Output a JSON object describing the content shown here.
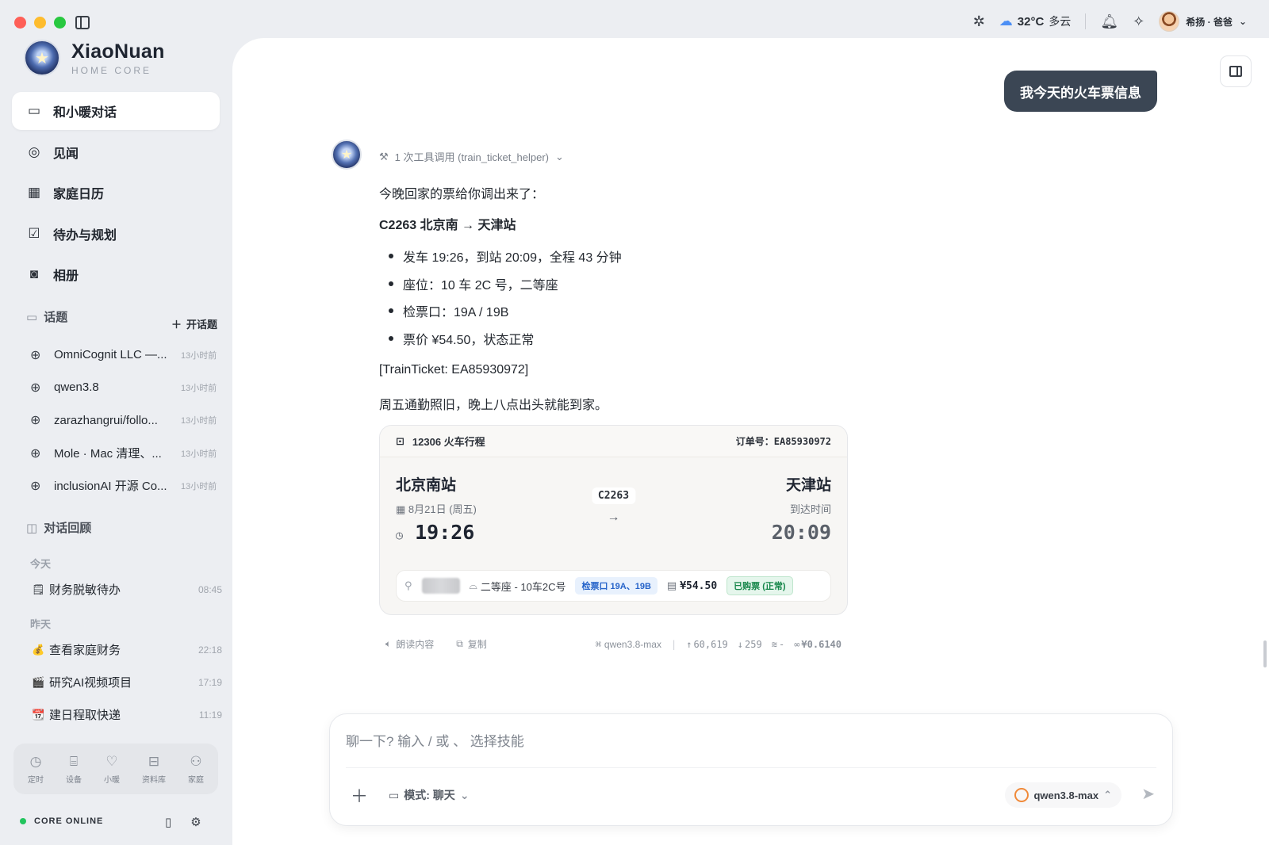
{
  "app": {
    "brand_name": "XiaoNuan",
    "brand_sub": "HOME CORE"
  },
  "topbar": {
    "temperature": "32°C",
    "condition": "多云",
    "user_name": "希扬 · 爸爸"
  },
  "nav": [
    {
      "label": "和小暖对话",
      "icon": "chat-icon",
      "active": true
    },
    {
      "label": "见闻",
      "icon": "compass-icon"
    },
    {
      "label": "家庭日历",
      "icon": "calendar-icon"
    },
    {
      "label": "待办与规划",
      "icon": "checkbox-icon"
    },
    {
      "label": "相册",
      "icon": "camera-icon"
    }
  ],
  "topics": {
    "title": "话题",
    "new_label": "开话题",
    "items": [
      {
        "name": "OmniCognit LLC —...",
        "time": "13小时前"
      },
      {
        "name": "qwen3.8",
        "time": "13小时前"
      },
      {
        "name": "zarazhangrui/follo...",
        "time": "13小时前"
      },
      {
        "name": "Mole · Mac 清理、...",
        "time": "13小时前"
      },
      {
        "name": "inclusionAI 开源 Co...",
        "time": "13小时前"
      }
    ]
  },
  "history": {
    "title": "对话回顾",
    "groups": [
      {
        "label": "今天",
        "items": [
          {
            "icon": "🗒",
            "name": "财务脱敏待办",
            "time": "08:45"
          }
        ]
      },
      {
        "label": "昨天",
        "items": [
          {
            "icon": "💰",
            "name": "查看家庭财务",
            "time": "22:18"
          },
          {
            "icon": "🎬",
            "name": "研究AI视频项目",
            "time": "17:19"
          },
          {
            "icon": "📆",
            "name": "建日程取快递",
            "time": "11:19"
          }
        ]
      }
    ]
  },
  "dock": [
    {
      "label": "定时",
      "icon": "clock-icon"
    },
    {
      "label": "设备",
      "icon": "router-icon"
    },
    {
      "label": "小暖",
      "icon": "heart-icon"
    },
    {
      "label": "资料库",
      "icon": "archive-icon"
    },
    {
      "label": "家庭",
      "icon": "family-icon"
    }
  ],
  "status": {
    "label": "CORE ONLINE",
    "color": "#22c55e"
  },
  "chat": {
    "user_message": "我今天的火车票信息",
    "tool_call": "1 次工具调用 (train_ticket_helper)",
    "intro": "今晚回家的票给你调出来了：",
    "title": "C2263 北京南 → 天津站",
    "bullets": [
      "发车 19:26，到站 20:09，全程 43 分钟",
      "座位：10 车 2C 号，二等座",
      "检票口：19A / 19B",
      "票价 ¥54.50，状态正常"
    ],
    "ref": "[TrainTicket: EA85930972]",
    "outro": "周五通勤照旧，晚上八点出头就能到家。"
  },
  "ticket": {
    "header": "12306 火车行程",
    "order": "订单号：EA85930972",
    "from_station": "北京南站",
    "from_date": "8月21日 (周五)",
    "depart_time": "19:26",
    "train_no": "C2263",
    "to_station": "天津站",
    "arrive_label": "到达时间",
    "arrive_time": "20:09",
    "seat": "二等座 - 10车2C号",
    "gate": "检票口 19A、19B",
    "price": "¥54.50",
    "status": "已购票 (正常)"
  },
  "msg_actions": {
    "read_aloud": "朗读内容",
    "copy": "复制",
    "model": "qwen3.8-max",
    "tokens_up": "60,619",
    "tokens_down": "259",
    "layers": "-",
    "cost": "¥0.6140"
  },
  "composer": {
    "placeholder": "聊一下? 输入 / 或 、 选择技能",
    "mode": "模式: 聊天",
    "model": "qwen3.8-max"
  }
}
